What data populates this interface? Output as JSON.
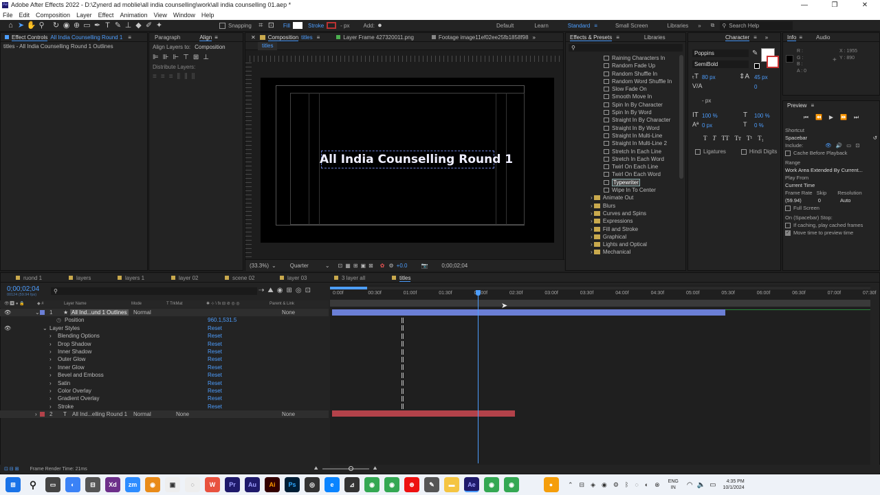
{
  "title_bar": {
    "text": "Adobe After Effects 2022 - D:\\Zynerd ad moblie\\all india counselling\\work\\all india counselling 01.aep *",
    "minimize": "—",
    "maximize": "❐",
    "close": "✕"
  },
  "menu": [
    "File",
    "Edit",
    "Composition",
    "Layer",
    "Effect",
    "Animation",
    "View",
    "Window",
    "Help"
  ],
  "toolbar": {
    "snapping": "Snapping",
    "fill": "Fill",
    "stroke": "Stroke",
    "px": "- px",
    "add": "Add:"
  },
  "workspaces": {
    "default": "Default",
    "learn": "Learn",
    "standard": "Standard",
    "small_screen": "Small Screen",
    "libraries": "Libraries",
    "search_placeholder": "Search Help"
  },
  "effect_controls": {
    "tab": "Effect Controls",
    "layer": "All India Counselling Round 1",
    "subtitle": "titles - All India Counselling Round 1 Outlines"
  },
  "paragraph_tab": "Paragraph",
  "align": {
    "tab": "Align",
    "align_to_label": "Align Layers to:",
    "align_to_value": "Composition",
    "distribute": "Distribute Layers:"
  },
  "composition": {
    "tab": "Composition",
    "name": "titles",
    "layer_tab": "Layer Frame 427320011.png",
    "footage_tab": "Footage image11ef02ee25fb1858f98",
    "inner_tab": "titles",
    "title_text": "All India Counselling Round 1",
    "zoom": "(33.3%)",
    "resolution": "Quarter",
    "exposure": "+0.0",
    "timecode": "0;00;02;04"
  },
  "effects_presets": {
    "tab": "Effects & Presets",
    "items": [
      {
        "label": "Raining Characters In",
        "kind": "preset"
      },
      {
        "label": "Random Fade Up",
        "kind": "preset"
      },
      {
        "label": "Random Shuffle In",
        "kind": "preset"
      },
      {
        "label": "Random Word Shuffle In",
        "kind": "preset"
      },
      {
        "label": "Slow Fade On",
        "kind": "preset"
      },
      {
        "label": "Smooth Move In",
        "kind": "preset"
      },
      {
        "label": "Spin In By Character",
        "kind": "preset"
      },
      {
        "label": "Spin In By Word",
        "kind": "preset"
      },
      {
        "label": "Straight In By Character",
        "kind": "preset"
      },
      {
        "label": "Straight In By Word",
        "kind": "preset"
      },
      {
        "label": "Straight In Multi-Line",
        "kind": "preset"
      },
      {
        "label": "Straight In Multi-Line 2",
        "kind": "preset"
      },
      {
        "label": "Stretch In Each Line",
        "kind": "preset"
      },
      {
        "label": "Stretch In Each Word",
        "kind": "preset"
      },
      {
        "label": "Twirl On Each Line",
        "kind": "preset"
      },
      {
        "label": "Twirl On Each Word",
        "kind": "preset"
      },
      {
        "label": "Typewriter",
        "kind": "preset",
        "selected": true
      },
      {
        "label": "Wipe In To Center",
        "kind": "preset"
      },
      {
        "label": "Animate Out",
        "kind": "folder"
      },
      {
        "label": "Blurs",
        "kind": "folder"
      },
      {
        "label": "Curves and Spins",
        "kind": "folder"
      },
      {
        "label": "Expressions",
        "kind": "folder"
      },
      {
        "label": "Fill and Stroke",
        "kind": "folder"
      },
      {
        "label": "Graphical",
        "kind": "folder"
      },
      {
        "label": "Lights and Optical",
        "kind": "folder"
      },
      {
        "label": "Mechanical",
        "kind": "folder"
      }
    ]
  },
  "libraries_tab": "Libraries",
  "character": {
    "tab": "Character",
    "font": "Poppins",
    "style": "SemiBold",
    "size": "80 px",
    "leading": "45 px",
    "tracking": "0",
    "px": "- px",
    "vscale": "100 %",
    "hscale": "100 %",
    "baseline": "0 px",
    "tsume": "0 %",
    "ligatures": "Ligatures",
    "hindi": "Hindi Digits"
  },
  "info": {
    "tab": "Info",
    "audio_tab": "Audio",
    "r": "R :",
    "g": "G :",
    "b": "B :",
    "a": "A : 0",
    "x": "X : 1955",
    "y": "Y : 890"
  },
  "preview": {
    "tab": "Preview",
    "shortcut_label": "Shortcut",
    "shortcut": "Spacebar",
    "include": "Include:",
    "cache": "Cache Before Playback",
    "range_label": "Range",
    "range": "Work Area Extended By Current...",
    "play_from_label": "Play From",
    "play_from": "Current Time",
    "frame_rate_label": "Frame Rate",
    "skip_label": "Skip",
    "resolution_label": "Resolution",
    "frame_rate": "(59.94)",
    "skip": "0",
    "resolution": "Auto",
    "full_screen": "Full Screen",
    "on_stop": "On (Spacebar) Stop:",
    "if_caching": "If caching, play cached frames",
    "move_time": "Move time to preview time"
  },
  "timeline_tabs": [
    {
      "label": "ruond 1"
    },
    {
      "label": "layers"
    },
    {
      "label": "layers 1"
    },
    {
      "label": "layer 02"
    },
    {
      "label": "scene 02"
    },
    {
      "label": "layer 03"
    },
    {
      "label": "3 layer all"
    },
    {
      "label": "titles",
      "active": true
    }
  ],
  "timeline": {
    "timecode": "0;00;02;04",
    "timecode_sub": "00124 (59.94 fps)",
    "col_layer_name": "Layer Name",
    "col_mode": "Mode",
    "col_trkmat": "T  TrkMat",
    "col_parent": "Parent & Link",
    "ruler": [
      "0:00f",
      "00:30f",
      "01:00f",
      "01:30f",
      "02:00f",
      "02:30f",
      "03:00f",
      "03:30f",
      "04:00f",
      "04:30f",
      "05:00f",
      "05:30f",
      "06:00f",
      "06:30f",
      "07:00f",
      "07:30f"
    ],
    "layer1": {
      "num": "1",
      "name": "All Ind...und 1 Outlines",
      "mode": "Normal",
      "parent": "None"
    },
    "position_label": "Position",
    "position_value": "960.1,531.5",
    "layer_styles": "Layer Styles",
    "styles": [
      "Blending Options",
      "Drop Shadow",
      "Inner Shadow",
      "Outer Glow",
      "Inner Glow",
      "Bevel and Emboss",
      "Satin",
      "Color Overlay",
      "Gradient Overlay",
      "Stroke"
    ],
    "reset": "Reset",
    "layer2": {
      "num": "2",
      "name": "All Ind...elling Round 1",
      "mode": "Normal",
      "trkmat": "None",
      "parent": "None"
    },
    "render_time": "Frame Render Time: 21ms",
    "playhead_fraction": 0.274,
    "bar1_end_fraction": 0.731,
    "bar2_end_fraction": 0.342
  },
  "taskbar": {
    "lang": "ENG",
    "region": "IN",
    "time": "4:35 PM",
    "date": "10/1/2024"
  },
  "colors": {
    "accent": "#4d9eff",
    "layer1": "#6b7fd6",
    "layer2": "#b3424a"
  }
}
